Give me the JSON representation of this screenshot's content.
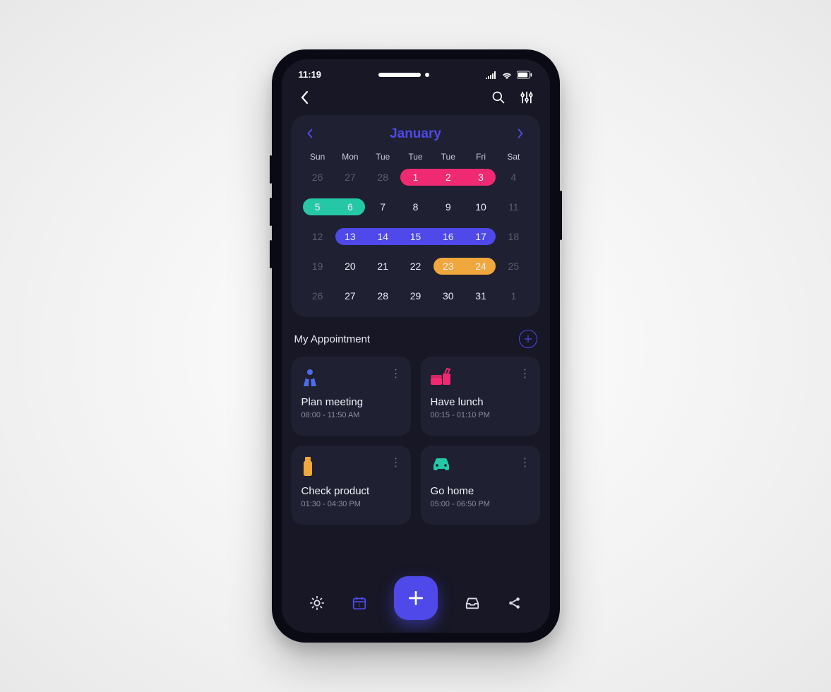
{
  "status": {
    "time": "11:19"
  },
  "calendar": {
    "month": "January",
    "weekdays": [
      "Sun",
      "Mon",
      "Tue",
      "Tue",
      "Tue",
      "Fri",
      "Sat"
    ],
    "rows": [
      [
        {
          "d": "26",
          "m": true
        },
        {
          "d": "27",
          "m": true
        },
        {
          "d": "28",
          "m": true
        },
        {
          "d": "1"
        },
        {
          "d": "2"
        },
        {
          "d": "3"
        },
        {
          "d": "4",
          "m": true
        }
      ],
      [
        {
          "d": "5"
        },
        {
          "d": "6"
        },
        {
          "d": "7"
        },
        {
          "d": "8"
        },
        {
          "d": "9"
        },
        {
          "d": "10"
        },
        {
          "d": "11",
          "m": true
        }
      ],
      [
        {
          "d": "12",
          "m": true
        },
        {
          "d": "13"
        },
        {
          "d": "14"
        },
        {
          "d": "15"
        },
        {
          "d": "16"
        },
        {
          "d": "17"
        },
        {
          "d": "18",
          "m": true
        }
      ],
      [
        {
          "d": "19",
          "m": true
        },
        {
          "d": "20"
        },
        {
          "d": "21"
        },
        {
          "d": "22"
        },
        {
          "d": "23"
        },
        {
          "d": "24"
        },
        {
          "d": "25",
          "m": true
        }
      ],
      [
        {
          "d": "26",
          "m": true
        },
        {
          "d": "27"
        },
        {
          "d": "28"
        },
        {
          "d": "29"
        },
        {
          "d": "30"
        },
        {
          "d": "31"
        },
        {
          "d": "1",
          "m": true
        }
      ]
    ],
    "ranges": [
      {
        "row": 0,
        "start": 3,
        "end": 5,
        "color": "#ef2a72"
      },
      {
        "row": 1,
        "start": 0,
        "end": 1,
        "color": "#24c8a6"
      },
      {
        "row": 2,
        "start": 1,
        "end": 5,
        "color": "#4e49e8"
      },
      {
        "row": 3,
        "start": 4,
        "end": 5,
        "color": "#f0a73c"
      }
    ]
  },
  "section": {
    "title": "My Appointment"
  },
  "appointments": [
    {
      "icon": "person",
      "color": "#4e6be8",
      "title": "Plan meeting",
      "time": "08:00 - 11:50 AM"
    },
    {
      "icon": "food",
      "color": "#ef2a72",
      "title": "Have lunch",
      "time": "00:15 - 01:10 PM"
    },
    {
      "icon": "bottle",
      "color": "#f0a73c",
      "title": "Check product",
      "time": "01:30 - 04:30 PM"
    },
    {
      "icon": "car",
      "color": "#24c8a6",
      "title": "Go home",
      "time": "05:00 - 06:50 PM"
    }
  ]
}
